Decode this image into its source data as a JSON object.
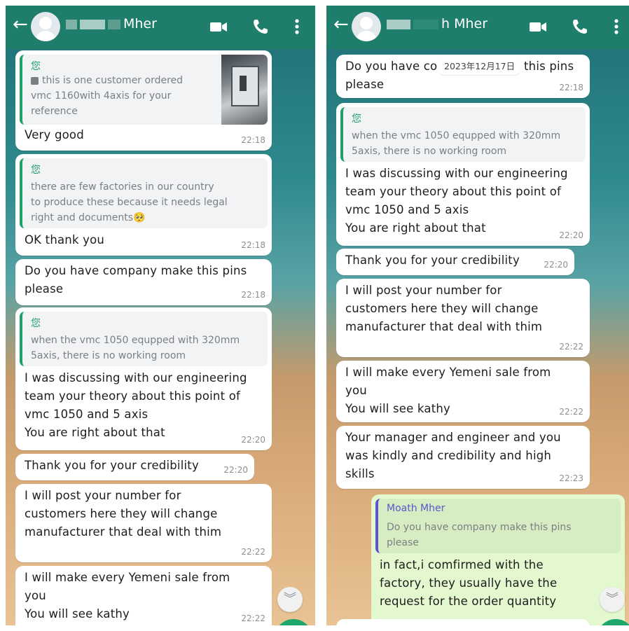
{
  "left": {
    "header": {
      "contact_name_visible": "Mher",
      "back_icon": "←"
    },
    "messages": [
      {
        "quote_author": "您",
        "quote_text": "this is one customer ordered\nvmc 1160with 4axis for your\nreference",
        "text": "Very good",
        "time": "22:18"
      },
      {
        "quote_author": "您",
        "quote_text": "there are few factories  in our country\nto produce these because it needs legal\nright and documents🥺",
        "text": "OK thank you",
        "time": "22:18"
      },
      {
        "text": "Do you have company make this pins\nplease",
        "time": "22:18"
      },
      {
        "quote_author": "您",
        "quote_text": "when the vmc 1050 equpped with 320mm\n5axis, there is no working  room",
        "text": "I was discussing with our engineering\nteam your theory about this point of\nvmc 1050 and 5 axis\nYou are right about that",
        "time": "22:20"
      },
      {
        "text": "Thank you for your credibility",
        "time": "22:20"
      },
      {
        "text": "I will  post your number for\ncustomers  here they will change\nmanufacturer that deal with thim",
        "time": "22:22"
      },
      {
        "text": "I will make every Yemeni sale from\nyou\nYou will see kathy",
        "time": "22:22"
      }
    ]
  },
  "right": {
    "header": {
      "contact_name_visible": "h Mher",
      "back_icon": "←"
    },
    "date_chip": "2023年12月17日",
    "messages": [
      {
        "text": "Do you have co",
        "text_tail": "this pins",
        "text2": "please",
        "time": "22:18"
      },
      {
        "quote_author": "您",
        "quote_text": "when the vmc 1050 equpped with 320mm\n5axis, there is no working  room",
        "text": "I was discussing with our engineering\nteam your theory about this point of\nvmc 1050 and 5 axis\nYou are right about that",
        "time": "22:20"
      },
      {
        "text": "Thank you for your credibility",
        "time": "22:20"
      },
      {
        "text": "I will  post your number for\ncustomers  here they will change\nmanufacturer that deal with thim",
        "time": "22:22"
      },
      {
        "text": "I will make every Yemeni sale from\nyou\nYou will see kathy",
        "time": "22:22"
      },
      {
        "text": "Your manager and engineer and you\nwas kindly and credibility and high\nskills",
        "time": "22:23"
      },
      {
        "quote_author": "Moath Mher",
        "quote_text": "Do you have company make this pins\nplease",
        "text": "in fact,i comfirmed with    the\nfactory, they usually have the\nrequest for the order quantity"
      }
    ]
  },
  "icons": {
    "video": "video-call-icon",
    "phone": "voice-call-icon",
    "menu": "more-options-icon",
    "scroll": "scroll-down-icon"
  },
  "colors": {
    "header": "#1f7d6c",
    "incoming_bubble": "#ffffff",
    "outgoing_bubble": "#e3f8cf",
    "quote_bar_self": "#1fa06a",
    "quote_bar_other": "#5b55c9",
    "fab": "#1fa66a"
  }
}
